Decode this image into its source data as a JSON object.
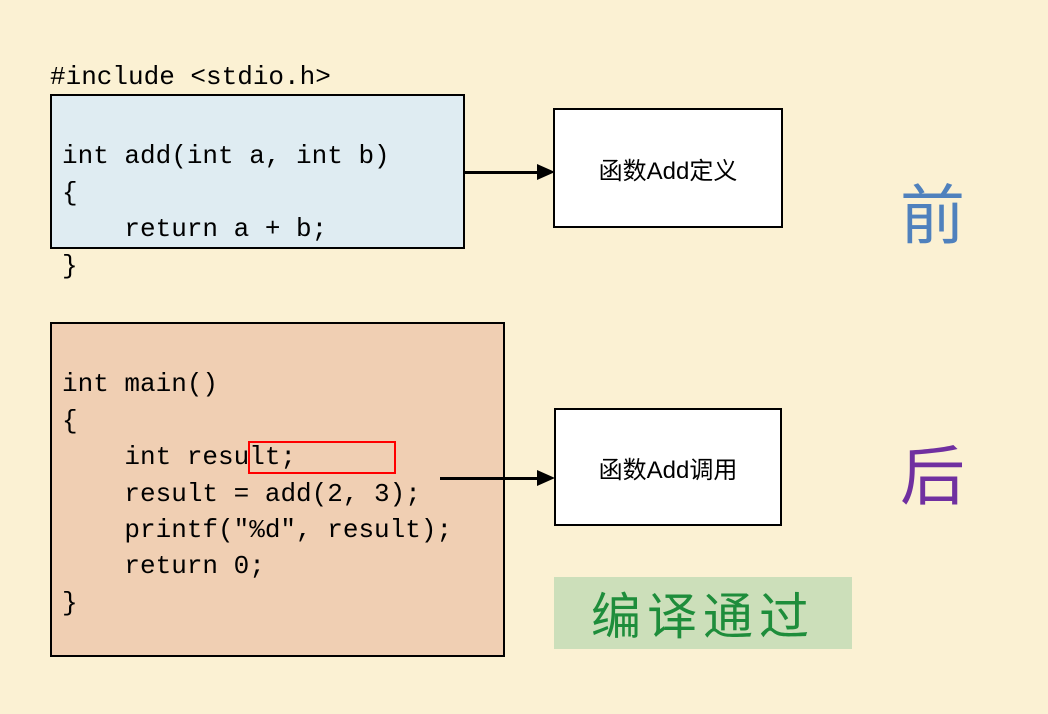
{
  "include_line": "#include <stdio.h>",
  "code_box_1": {
    "line1": "int add(int a, int b)",
    "line2": "{",
    "line3": "    return a + b;",
    "line4": "}"
  },
  "code_box_2": {
    "line1": "int main()",
    "line2": "{",
    "line3": "    int result;",
    "line4_pre": "    result = ",
    "line4_hl": "add(2, 3)",
    "line4_post": ";",
    "line5": "    printf(\"%d\", result);",
    "line6": "    return 0;",
    "line7": "}"
  },
  "label1": "函数Add定义",
  "label2": "函数Add调用",
  "char_before": "前",
  "char_after": "后",
  "compile_pass": "编译通过"
}
